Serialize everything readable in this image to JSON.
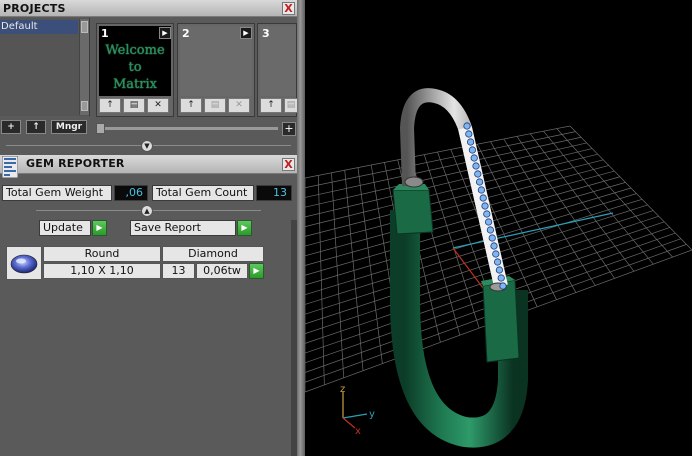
{
  "projects": {
    "title": "PROJECTS",
    "close_label": "X",
    "list_item": "Default",
    "toolbar": {
      "add_label": "+",
      "up_label": "↑",
      "manager_label": "Mngr"
    },
    "slots": [
      {
        "number": "1",
        "thumbnail_line1": "Welcome to",
        "thumbnail_line2": "Matrix"
      },
      {
        "number": "2"
      },
      {
        "number": "3"
      }
    ],
    "slot_buttons": {
      "up": "↑",
      "save": "▤",
      "delete": "✕"
    },
    "slider_add_label": "+"
  },
  "gem_reporter": {
    "title": "GEM REPORTER",
    "close_label": "X",
    "total_weight_label": "Total Gem Weight",
    "total_weight_value": ",06",
    "total_count_label": "Total Gem Count",
    "total_count_value": "13",
    "update_label": "Update",
    "save_report_label": "Save Report",
    "table": {
      "shape": "Round",
      "material": "Diamond",
      "size": "1,10 X 1,10",
      "count": "13",
      "weight": "0,06tw"
    }
  },
  "viewport": {
    "axis_z": "z",
    "axis_y": "y",
    "axis_x": "x"
  },
  "colors": {
    "selection": "#3c4f7a",
    "value_text": "#4bc0e0",
    "go_button": "#2a9a2a",
    "ring_green": "#1e6e4a",
    "grid": "#6a6a6a",
    "axis_red": "#c03020",
    "axis_cyan": "#2aa0b8"
  },
  "icons": [
    "gem-report-icon",
    "close-icon",
    "play-icon",
    "arrow-up-icon",
    "save-icon",
    "delete-icon",
    "collapse-icon",
    "go-arrow-icon",
    "round-gem-icon"
  ]
}
